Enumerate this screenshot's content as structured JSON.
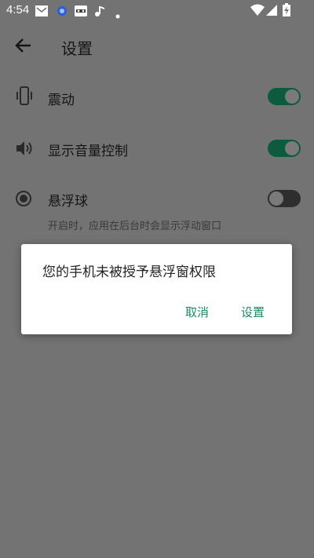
{
  "status_bar": {
    "time": "4:54",
    "left_icons": [
      "mail-icon",
      "app-icon",
      "cat-app-icon",
      "music-note-icon",
      "dot-icon"
    ],
    "right_icons": [
      "wifi-icon",
      "signal-icon",
      "battery-charging-icon"
    ]
  },
  "app_bar": {
    "back_icon": "back-arrow-icon",
    "title": "设置"
  },
  "settings": {
    "vibration": {
      "label": "震动",
      "icon": "phone-vibrate-icon",
      "enabled": true
    },
    "volume_control": {
      "label": "显示音量控制",
      "icon": "speaker-icon",
      "enabled": true
    },
    "floating_ball": {
      "label": "悬浮球",
      "description": "开启时，应用在后台时会显示浮动窗口",
      "icon": "radio-button-icon",
      "enabled": false
    }
  },
  "dialog": {
    "message": "您的手机未被授予悬浮窗权限",
    "cancel_label": "取消",
    "settings_label": "设置"
  },
  "colors": {
    "scrim_background": "#737373",
    "toggle_on": "#0c5b3e",
    "dialog_button": "#1b8a63"
  }
}
